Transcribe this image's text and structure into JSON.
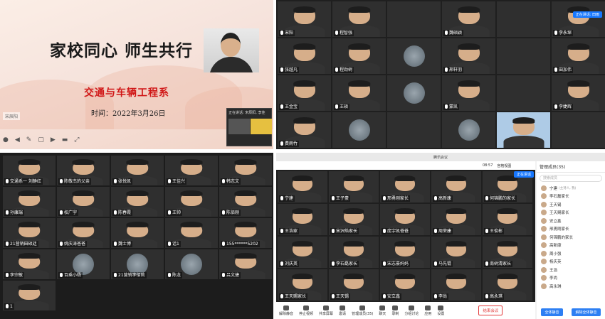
{
  "panel1": {
    "slide_title": "家校同心 师生共行",
    "slide_dept": "交通与车辆工程系",
    "slide_time": "时间：2022年3月26日",
    "speaker_label": "宋辰阳",
    "mini_label": "正在讲话: 宋辰阳, 李佳",
    "toolbar": [
      "●",
      "◀",
      "✎",
      "▢",
      "▶",
      "▬",
      "⤢"
    ]
  },
  "panel2": {
    "tiles": [
      {
        "name": "宋阳"
      },
      {
        "name": "程智强"
      },
      {
        "name": ""
      },
      {
        "name": "魏硕颖"
      },
      {
        "name": ""
      },
      {
        "name": "李永琛"
      },
      {
        "name": "张越凡"
      },
      {
        "name": "程劲树"
      },
      {
        "name": ""
      },
      {
        "name": "邢轩羽"
      },
      {
        "name": ""
      },
      {
        "name": "田加伟"
      },
      {
        "name": "王金宝"
      },
      {
        "name": "王硕"
      },
      {
        "name": ""
      },
      {
        "name": "蒙凯"
      },
      {
        "name": ""
      },
      {
        "name": "李婕辉"
      },
      {
        "name": "费雨竹"
      },
      {
        "name": ""
      },
      {
        "name": ""
      },
      {
        "name": ""
      },
      {
        "name": ""
      },
      {
        "name": ""
      }
    ],
    "speaking": "正在讲话: 田雨"
  },
  "panel3": {
    "tiles": [
      {
        "name": "交通系一 刘静红"
      },
      {
        "name": "陈敬杰的父亲"
      },
      {
        "name": "张悦凯"
      },
      {
        "name": "王佳兴"
      },
      {
        "name": "韩志文"
      },
      {
        "name": "孙康瑞"
      },
      {
        "name": "权广宇"
      },
      {
        "name": "陈春霞"
      },
      {
        "name": "王帅"
      },
      {
        "name": "陈佰刚"
      },
      {
        "name": "21营销田硕廷"
      },
      {
        "name": "姚庆涛爸爸"
      },
      {
        "name": "魏士博"
      },
      {
        "name": "话1"
      },
      {
        "name": "155******5202"
      },
      {
        "name": "李宗敏"
      },
      {
        "name": "百乘小杨"
      },
      {
        "name": "21营销李佰莉"
      },
      {
        "name": "陈龙"
      },
      {
        "name": "吕文捷"
      },
      {
        "name": "1"
      }
    ]
  },
  "panel4": {
    "window_title": "腾讯会议",
    "time": "08:57",
    "view_label": "宫格视图",
    "members_title": "管理成员(35)",
    "search_placeholder": "搜索成员",
    "speaking": "正在讲话",
    "tiles": [
      {
        "name": "宁建"
      },
      {
        "name": "王子豪"
      },
      {
        "name": "邢勇刚家长"
      },
      {
        "name": "高新康"
      },
      {
        "name": "何锦鹏的家长"
      },
      {
        "name": "王浩家"
      },
      {
        "name": "宋沢皓家长"
      },
      {
        "name": "庞宇凯爸爸"
      },
      {
        "name": "周荣康"
      },
      {
        "name": "王俊彬"
      },
      {
        "name": "刘庆英"
      },
      {
        "name": "李石磊家长"
      },
      {
        "name": "宋志豪妈妈"
      },
      {
        "name": "马先锟"
      },
      {
        "name": "南树清家长"
      },
      {
        "name": "王天赐家长"
      },
      {
        "name": "王天锡"
      },
      {
        "name": "安立鑫"
      },
      {
        "name": "李尚"
      },
      {
        "name": "高永琪"
      }
    ],
    "members": [
      {
        "name": "宁建",
        "sub": "(主持人, 我)"
      },
      {
        "name": "李石磊家长",
        "sub": ""
      },
      {
        "name": "王天锡",
        "sub": ""
      },
      {
        "name": "王天赐家长",
        "sub": ""
      },
      {
        "name": "安立鑫",
        "sub": ""
      },
      {
        "name": "邢勇刚家长",
        "sub": ""
      },
      {
        "name": "何锦鹏的家长",
        "sub": ""
      },
      {
        "name": "高新康",
        "sub": ""
      },
      {
        "name": "周小强",
        "sub": ""
      },
      {
        "name": "杨庆英",
        "sub": ""
      },
      {
        "name": "王浩",
        "sub": ""
      },
      {
        "name": "李尚",
        "sub": ""
      },
      {
        "name": "高永琪",
        "sub": ""
      }
    ],
    "mute_all": "全体静音",
    "unmute_all": "解除全体静音",
    "bottom_bar": [
      "解除静音",
      "停止视频",
      "共享屏幕",
      "邀请",
      "管理成员(35)",
      "聊天",
      "录制",
      "分组讨论",
      "应用",
      "设置"
    ],
    "end_label": "结束会议"
  }
}
